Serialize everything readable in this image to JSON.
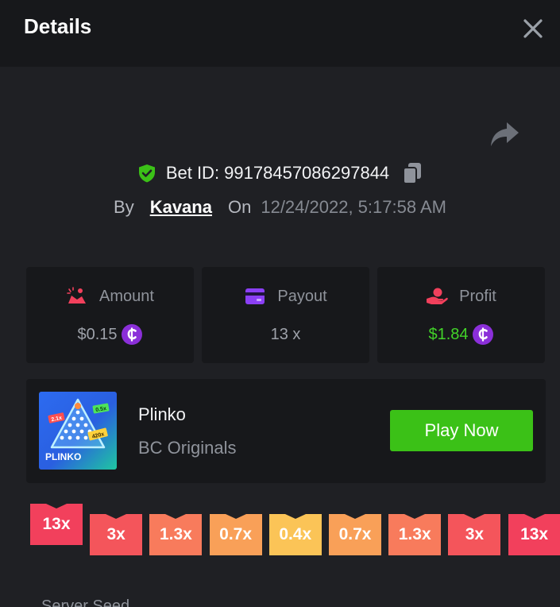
{
  "header": {
    "title": "Details"
  },
  "icons": {
    "close": "close-icon",
    "share": "share-arrow-icon",
    "copy": "copy-icon",
    "verified": "shield-check-icon",
    "coin": "coin-icon"
  },
  "bet": {
    "id_text": "Bet ID: 99178457086297844",
    "by_label": "By",
    "username": "Kavana",
    "on_label": "On",
    "datetime": "12/24/2022, 5:17:58 AM"
  },
  "stats": {
    "amount": {
      "label": "Amount",
      "value": "$0.15"
    },
    "payout": {
      "label": "Payout",
      "value": "13 x"
    },
    "profit": {
      "label": "Profit",
      "value": "$1.84"
    }
  },
  "game": {
    "name": "Plinko",
    "provider": "BC Originals",
    "play_label": "Play Now",
    "thumb": {
      "title": "PLINKO",
      "tag_left": "2.1x",
      "tag_right": "0.5x",
      "tag_bottom": "420x"
    }
  },
  "multipliers": [
    "13x",
    "3x",
    "1.3x",
    "0.7x",
    "0.4x",
    "0.7x",
    "1.3x",
    "3x",
    "13x"
  ],
  "server_seed_label": "Server Seed",
  "colors": {
    "background": "#1f2024",
    "panel": "#17181b",
    "accent_green": "#3bc117",
    "profit_green": "#42d329",
    "coin_purple": "#8b2fd9",
    "mult_red": "#f2405c",
    "mult_orange": "#f87b5c",
    "mult_light_orange": "#f9a058",
    "mult_yellow": "#fbc457"
  }
}
